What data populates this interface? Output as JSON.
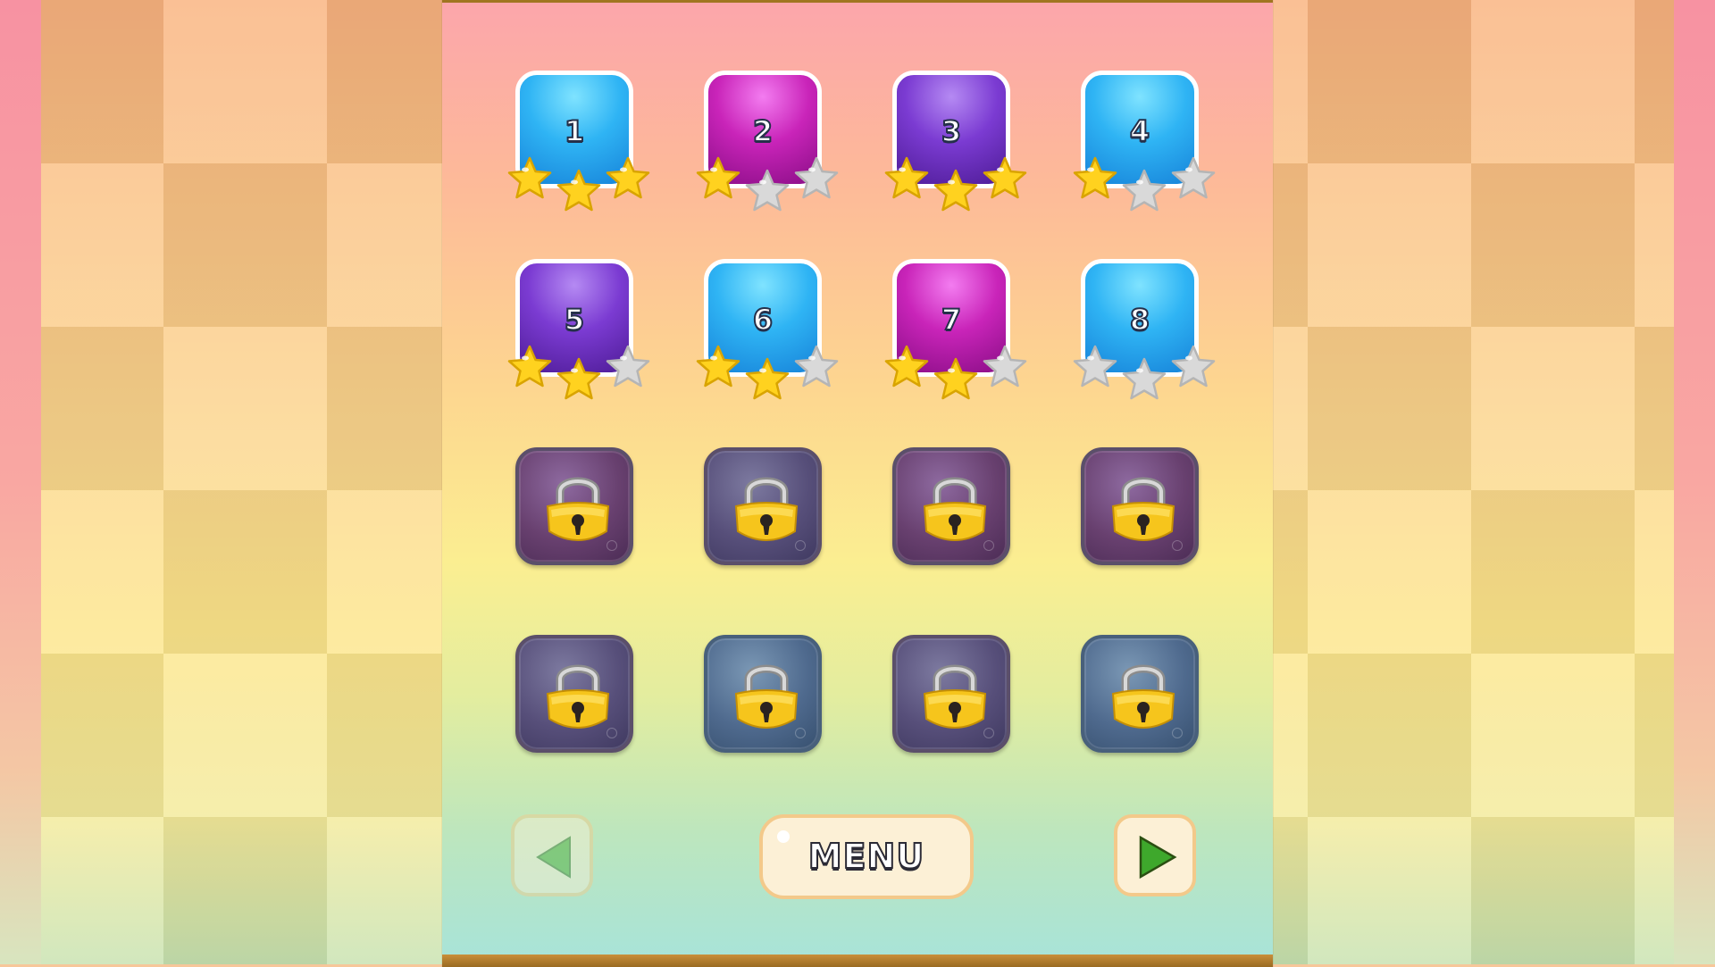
{
  "colors": {
    "panel_border": "#a07520",
    "tile_blue": "#2fb4f4",
    "tile_magenta": "#c924b9",
    "tile_purple": "#7b3bd2",
    "star_gold": "#ffd21f",
    "star_empty": "#d9d9d9",
    "arrow_green": "#3ea82c"
  },
  "levels": [
    {
      "label": "1",
      "color": "blue",
      "stars": 3
    },
    {
      "label": "2",
      "color": "magenta",
      "stars": 1
    },
    {
      "label": "3",
      "color": "purple",
      "stars": 3
    },
    {
      "label": "4",
      "color": "blue",
      "stars": 1
    },
    {
      "label": "5",
      "color": "purple",
      "stars": 2
    },
    {
      "label": "6",
      "color": "blue",
      "stars": 2
    },
    {
      "label": "7",
      "color": "magenta",
      "stars": 2
    },
    {
      "label": "8",
      "color": "blue",
      "stars": 0
    }
  ],
  "locked_levels": [
    {
      "style": "plum",
      "icon": "padlock-icon"
    },
    {
      "style": "slate",
      "icon": "padlock-icon"
    },
    {
      "style": "plum",
      "icon": "padlock-icon"
    },
    {
      "style": "plum",
      "icon": "padlock-icon"
    },
    {
      "style": "slate",
      "icon": "padlock-icon"
    },
    {
      "style": "steel",
      "icon": "padlock-icon"
    },
    {
      "style": "slate",
      "icon": "padlock-icon"
    },
    {
      "style": "steel",
      "icon": "padlock-icon"
    }
  ],
  "nav": {
    "prev_icon": "arrow-left-icon",
    "prev_enabled": false,
    "menu_label": "MENU",
    "next_icon": "arrow-right-icon",
    "next_enabled": true
  }
}
